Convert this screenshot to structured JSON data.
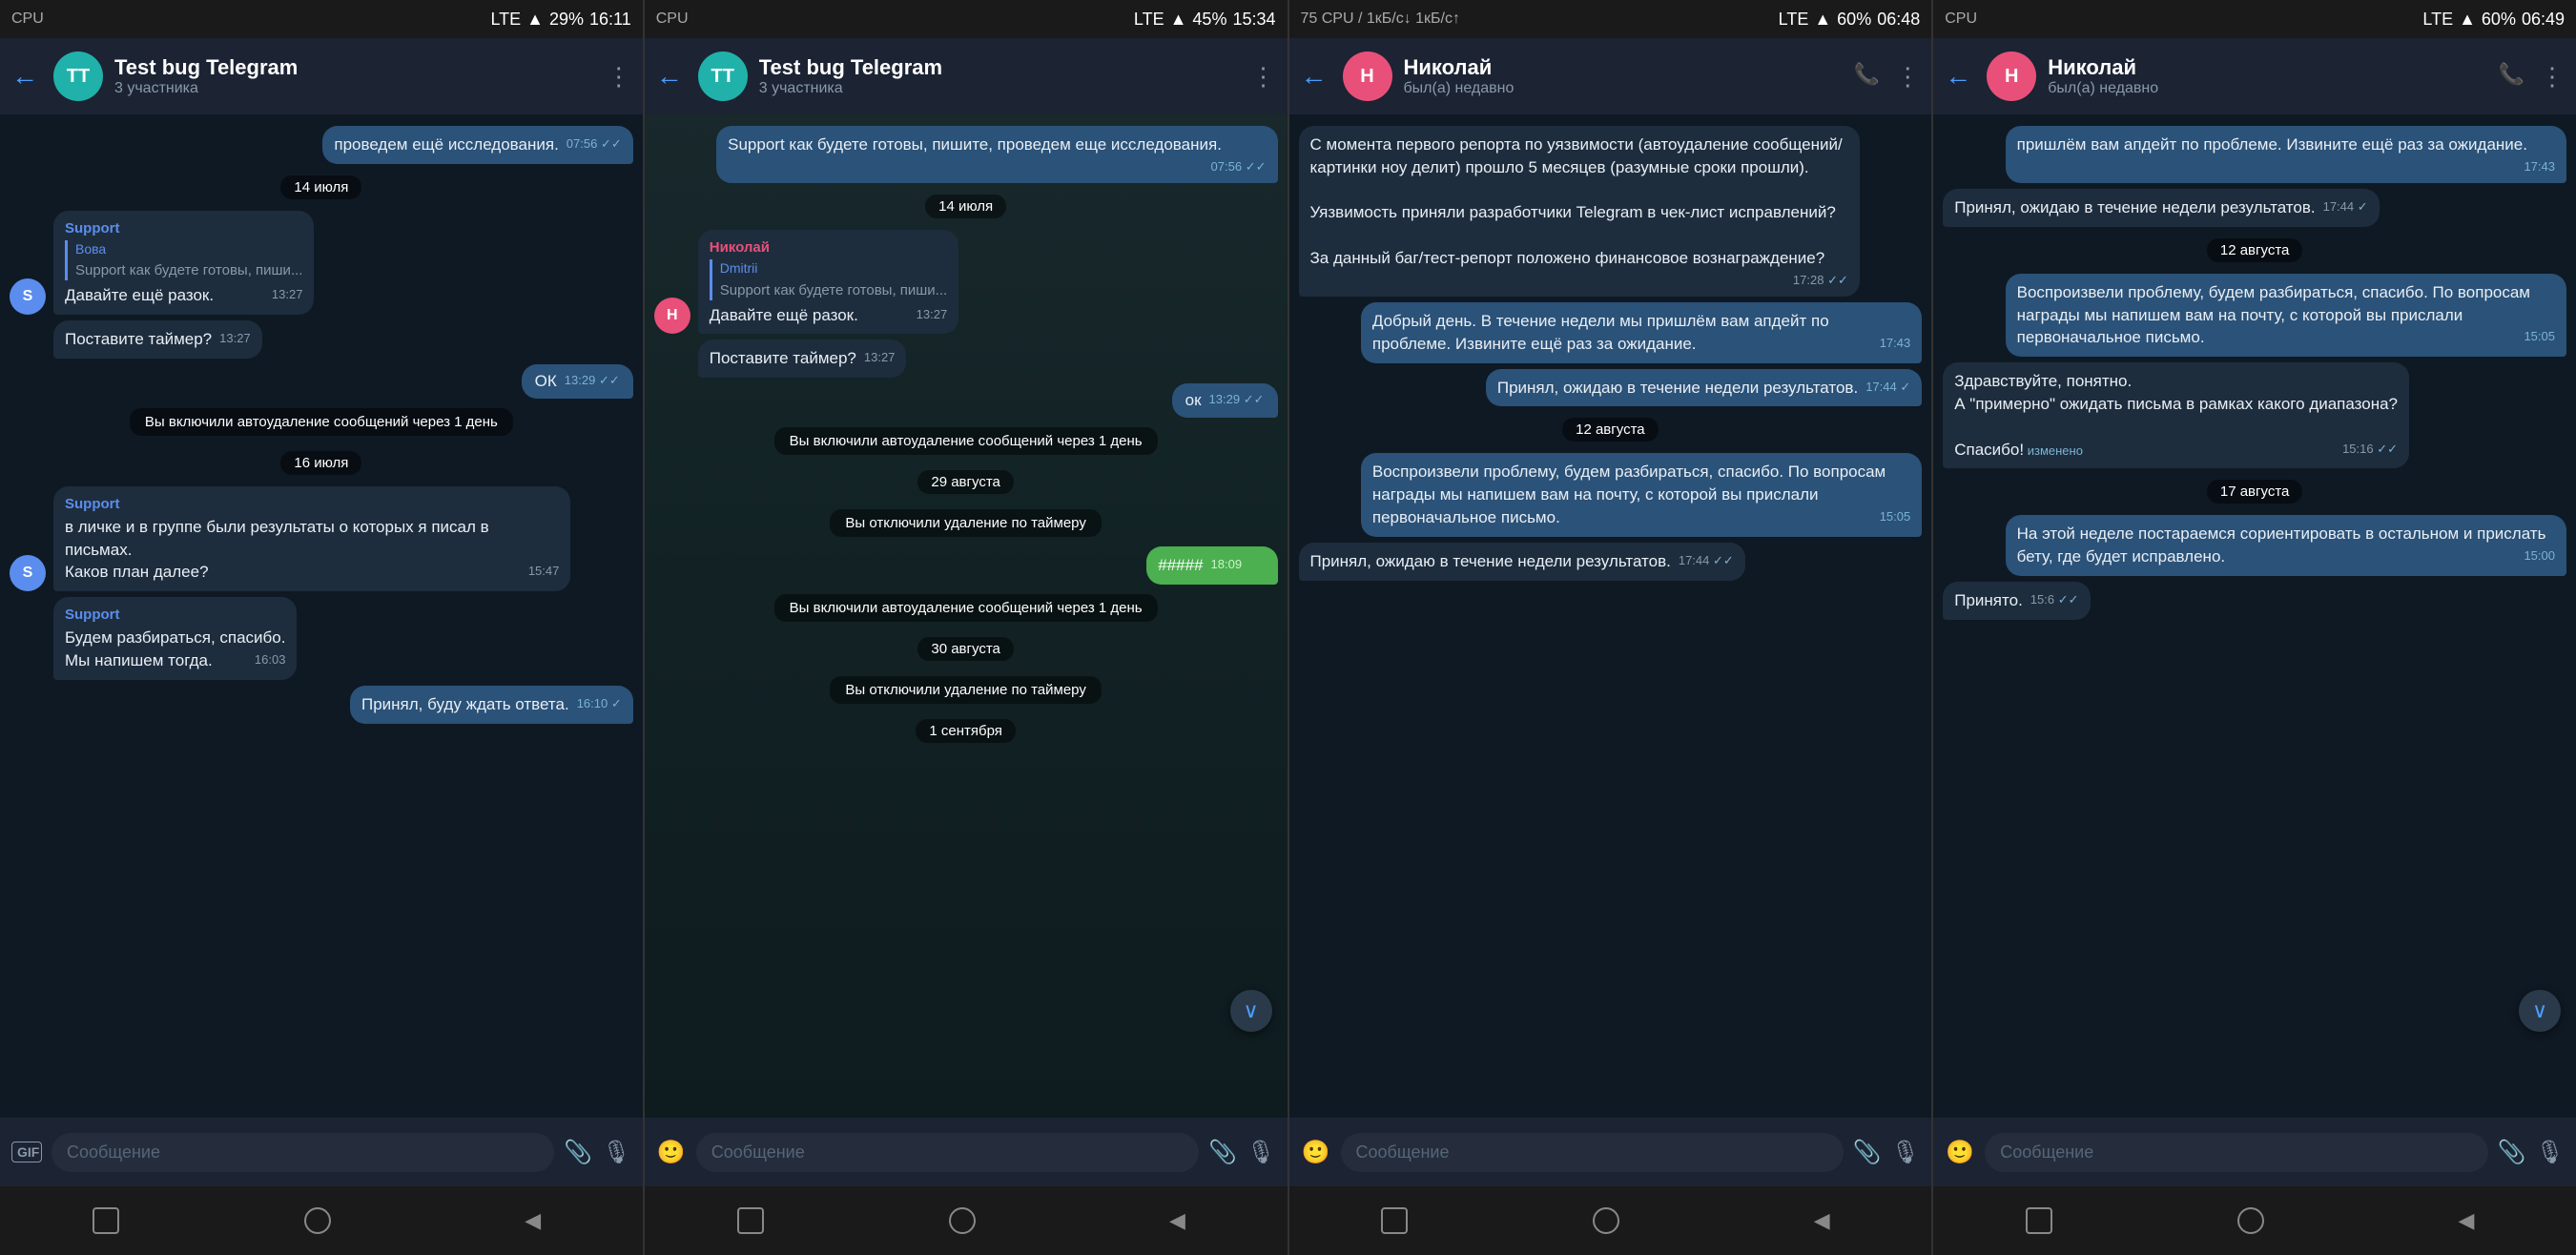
{
  "screens": [
    {
      "id": "screen1",
      "statusBar": {
        "left": "CPU",
        "network": "LTE",
        "signal": "▲",
        "battery": "29%",
        "time": "16:11"
      },
      "header": {
        "avatarInitials": "TT",
        "avatarColor": "teal",
        "name": "Test bug Telegram",
        "sub": "3 участника",
        "hasMore": true
      },
      "messages": [
        {
          "type": "outgoing",
          "text": "проведем ещё исследования.",
          "time": "07:56",
          "ticks": "✓✓"
        },
        {
          "type": "date",
          "text": "14 июля"
        },
        {
          "type": "incoming",
          "avatarLetter": "S",
          "avatarColor": "support",
          "senderName": "Support",
          "senderClass": "support",
          "replyName": "Вова",
          "replyText": "Support как будете готовы, пиши...",
          "text": "Давайте ещё разок.",
          "time": "13:27"
        },
        {
          "type": "incoming-no-avatar",
          "avatarLetter": "S",
          "avatarColor": "support",
          "text": "Поставите таймер?",
          "time": "13:27"
        },
        {
          "type": "outgoing",
          "text": "ОК",
          "time": "13:29",
          "ticks": "✓✓",
          "short": true
        },
        {
          "type": "system",
          "text": "Вы включили автоудаление сообщений через 1 день"
        },
        {
          "type": "date",
          "text": "16 июля"
        },
        {
          "type": "incoming",
          "avatarLetter": "S",
          "avatarColor": "support",
          "senderName": "Support",
          "senderClass": "support",
          "text": "в личке и в группе были результаты о которых я писал в письмах.\nКаков план далее?",
          "time": "15:47"
        },
        {
          "type": "incoming-cont",
          "avatarLetter": "S",
          "avatarColor": "support",
          "senderName": "Support",
          "senderClass": "support",
          "text": "Будем разбираться, спасибо.\nМы напишем тогда.",
          "time": "16:03"
        },
        {
          "type": "outgoing",
          "text": "Принял, буду ждать ответа.",
          "time": "16:10",
          "ticks": "✓"
        }
      ],
      "input": {
        "placeholder": "Сообщение",
        "hasGif": true
      }
    },
    {
      "id": "screen2",
      "statusBar": {
        "left": "CPU",
        "network": "LTE",
        "signal": "▲",
        "battery": "45%",
        "time": "15:34"
      },
      "header": {
        "avatarInitials": "TT",
        "avatarColor": "teal",
        "name": "Test bug Telegram",
        "sub": "3 участника",
        "hasMore": true
      },
      "messages": [
        {
          "type": "outgoing",
          "text": "Support как будете готовы, пишите, проведем еще исследования.",
          "time": "07:56",
          "ticks": "✓✓"
        },
        {
          "type": "date",
          "text": "14 июля"
        },
        {
          "type": "incoming",
          "avatarLetter": "H",
          "avatarColor": "nikolai",
          "senderName": "Николай",
          "senderClass": "nikolai",
          "replyName": "Dmitrii",
          "replyText": "Support как будете готовы, пиши...",
          "text": "Давайте ещё разок.",
          "time": "13:27"
        },
        {
          "type": "incoming-no-avatar",
          "text": "Поставите таймер?",
          "time": "13:27"
        },
        {
          "type": "outgoing",
          "text": "ок",
          "time": "13:29",
          "ticks": "✓✓",
          "short": true
        },
        {
          "type": "system",
          "text": "Вы включили автоудаление сообщений через 1 день"
        },
        {
          "type": "date",
          "text": "29 августа"
        },
        {
          "type": "system",
          "text": "Вы отключили удаление по таймеру"
        },
        {
          "type": "outgoing-censored",
          "text": "#####",
          "time": "18:09",
          "ticks": "✓✓"
        },
        {
          "type": "system",
          "text": "Вы включили автоудаление сообщений через 1 день"
        },
        {
          "type": "date",
          "text": "30 августа"
        },
        {
          "type": "system",
          "text": "Вы отключили удаление по таймеру"
        },
        {
          "type": "date",
          "text": "1 сентября"
        }
      ],
      "input": {
        "placeholder": "Сообщение",
        "hasGif": false
      },
      "hasScrollDown": true
    },
    {
      "id": "screen3",
      "statusBar": {
        "left": "75 CPU / 1кБ/с↓ 1кБ/с↑",
        "network": "LTE",
        "signal": "▲",
        "battery": "60%",
        "time": "06:48"
      },
      "header": {
        "avatarInitials": "H",
        "avatarColor": "pink",
        "name": "Николай",
        "sub": "был(а) недавно",
        "hasCall": true,
        "hasMore": true
      },
      "messages": [
        {
          "type": "incoming-plain",
          "text": "С момента первого репорта по уязвимости (автоудаление сообщений/картинки ноу делит) прошло 5 месяцев (разумные сроки прошли).\n\nУязвимость приняли разработчики Telegram в чек-лист исправлений?\n\nЗа данный баг/тест-репорт положено финансовое вознаграждение?",
          "time": "17:28",
          "ticks": "✓✓"
        },
        {
          "type": "outgoing",
          "text": "Добрый день. В течение недели мы пришлём вам апдейт по проблеме. Извините ещё раз за ожидание.",
          "time": "17:43"
        },
        {
          "type": "outgoing",
          "text": "Принял, ожидаю в течение недели результатов.",
          "time": "17:44",
          "ticks": "✓"
        },
        {
          "type": "date",
          "text": "12 августа"
        },
        {
          "type": "outgoing",
          "text": "Воспроизвели проблему, будем разбираться, спасибо. По вопросам награды мы напишем вам на почту, с которой вы прислали первоначальное письмо.",
          "time": "15:05"
        },
        {
          "type": "incoming-plain",
          "text": "Принял, ожидаю в течение недели результатов.",
          "time": "17:44",
          "ticks": "✓✓"
        }
      ],
      "input": {
        "placeholder": "Сообщение",
        "hasGif": false
      }
    },
    {
      "id": "screen4",
      "statusBar": {
        "left": "CPU",
        "network": "LTE",
        "signal": "▲",
        "battery": "60%",
        "time": "06:49"
      },
      "header": {
        "avatarInitials": "H",
        "avatarColor": "pink",
        "name": "Николай",
        "sub": "был(а) недавно",
        "hasCall": true,
        "hasMore": true
      },
      "messages": [
        {
          "type": "outgoing",
          "text": "пришлём вам апдейт по проблеме. Извините ещё раз за ожидание.",
          "time": "17:43"
        },
        {
          "type": "incoming-plain",
          "text": "Принял, ожидаю в течение недели результатов.",
          "time": "17:44",
          "ticks": "✓"
        },
        {
          "type": "date",
          "text": "12 августа"
        },
        {
          "type": "outgoing",
          "text": "Воспроизвели проблему, будем разбираться, спасибо. По вопросам награды мы напишем вам на почту, с которой вы прислали первоначальное письмо.",
          "time": "15:05"
        },
        {
          "type": "incoming-plain",
          "text": "Здравствуйте, понятно.\nА \"примерно\" ожидать письма в рамках какого диапазона?\n\nСпасибо!",
          "time": "15:16",
          "ticks": "✓✓",
          "changed": true
        },
        {
          "type": "date",
          "text": "17 августа"
        },
        {
          "type": "outgoing",
          "text": "На этой неделе постараемся сориентировать в остальном и прислать бету, где будет исправлено.",
          "time": "15:00"
        },
        {
          "type": "incoming-plain",
          "text": "Принято.",
          "time": "15:6",
          "ticks": "✓✓"
        }
      ],
      "input": {
        "placeholder": "Сообщение",
        "hasGif": false
      },
      "hasScrollDown": true
    }
  ],
  "labels": {
    "back": "←",
    "more": "⋮",
    "call": "📞",
    "gif": "GIF",
    "attachment": "📎",
    "mic": "🎙",
    "navSquare": "■",
    "navCircle": "●",
    "navTriangle": "◀",
    "scrollDown": "∨"
  }
}
